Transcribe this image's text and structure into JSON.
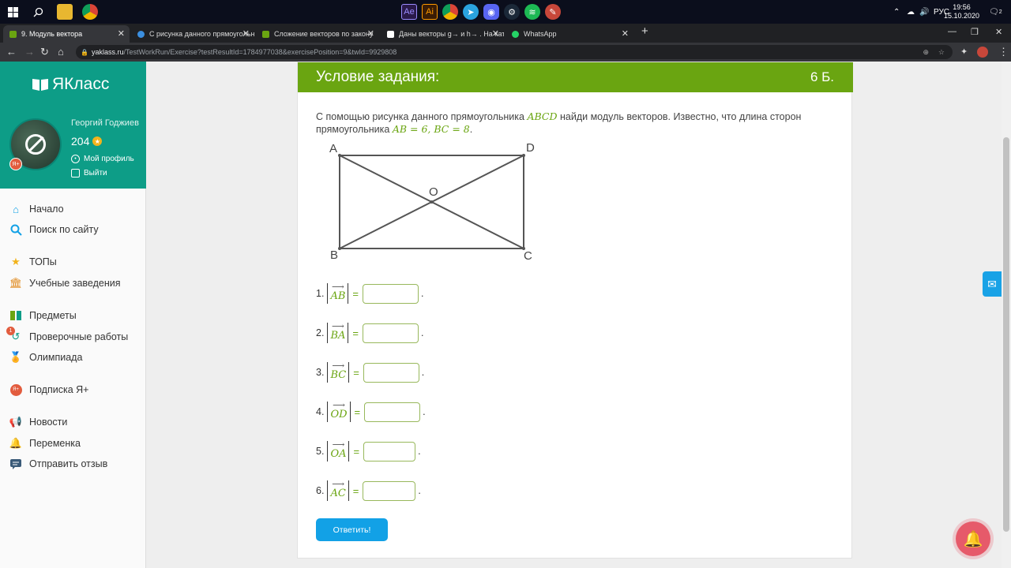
{
  "taskbar": {
    "lang": "РУС",
    "time": "19:56",
    "date": "15.10.2020",
    "notif_count": "2",
    "apps": [
      "Ae",
      "Ai"
    ]
  },
  "tabs": [
    {
      "label": "9. Модуль вектора",
      "active": true
    },
    {
      "label": "С рисунка данного прямоугольн",
      "active": false
    },
    {
      "label": "Сложение векторов по закону",
      "active": false
    },
    {
      "label": "Даны векторы g→ и h→ . На кат",
      "active": false
    },
    {
      "label": "WhatsApp",
      "active": false
    }
  ],
  "address": {
    "domain": "yaklass.ru",
    "path": "/TestWorkRun/Exercise?testResultId=1784977038&exercisePosition=9&twId=9929808"
  },
  "sidebar": {
    "logo": "ЯКласс",
    "user_name": "Георгий Годжиев",
    "score": "204",
    "ya_badge": "Я+",
    "profile_link": "Мой профиль",
    "logout_link": "Выйти",
    "items": [
      {
        "label": "Начало",
        "icon": "home-icon"
      },
      {
        "label": "Поиск по сайту",
        "icon": "search-icon"
      },
      {
        "label": "ТОПы",
        "icon": "star-icon"
      },
      {
        "label": "Учебные заведения",
        "icon": "school-icon"
      },
      {
        "label": "Предметы",
        "icon": "books-icon"
      },
      {
        "label": "Проверочные работы",
        "icon": "test-icon"
      },
      {
        "label": "Олимпиада",
        "icon": "medal-icon"
      },
      {
        "label": "Подписка Я+",
        "icon": "ya-plus-icon"
      },
      {
        "label": "Новости",
        "icon": "megaphone-icon"
      },
      {
        "label": "Переменка",
        "icon": "bell-icon"
      },
      {
        "label": "Отправить отзыв",
        "icon": "feedback-icon"
      }
    ],
    "test_badge": "1"
  },
  "task": {
    "header": "Условие задания:",
    "points": "6 Б.",
    "text_1": "С помощью рисунка данного прямоугольника",
    "rect_name": "ABCD",
    "text_2": "найди модуль векторов. Известно, что длина сторон прямоугольника",
    "sides": "AB = 6, BC = 8",
    "text_end": ".",
    "figure_labels": {
      "a": "A",
      "b": "B",
      "c": "C",
      "d": "D",
      "o": "O"
    },
    "equals": "=",
    "questions": [
      {
        "num": "1.",
        "vector": "AB",
        "value": ""
      },
      {
        "num": "2.",
        "vector": "BA",
        "value": ""
      },
      {
        "num": "3.",
        "vector": "BC",
        "value": ""
      },
      {
        "num": "4.",
        "vector": "OD",
        "value": ""
      },
      {
        "num": "5.",
        "vector": "OA",
        "value": ""
      },
      {
        "num": "6.",
        "vector": "AC",
        "value": ""
      }
    ],
    "submit_label": "Ответить!"
  }
}
